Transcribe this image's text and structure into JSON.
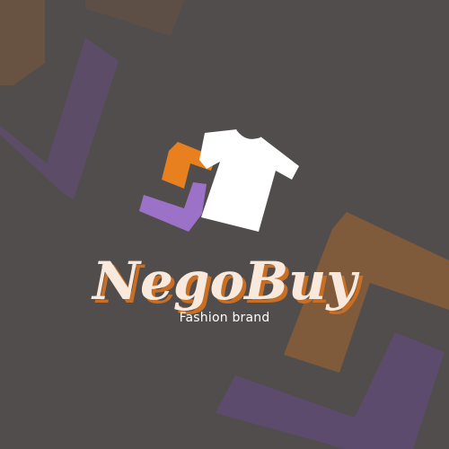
{
  "brand": {
    "name": "NegoBuy",
    "tagline": "Fashion brand"
  },
  "colors": {
    "background": "#514d4c",
    "orange": "#e8801f",
    "purple": "#9c72c9",
    "white": "#ffffff",
    "brand_text": "#f8e9dc",
    "brand_shadow": "#c86f25"
  },
  "icons": {
    "logo": "t-shirt-icon"
  }
}
